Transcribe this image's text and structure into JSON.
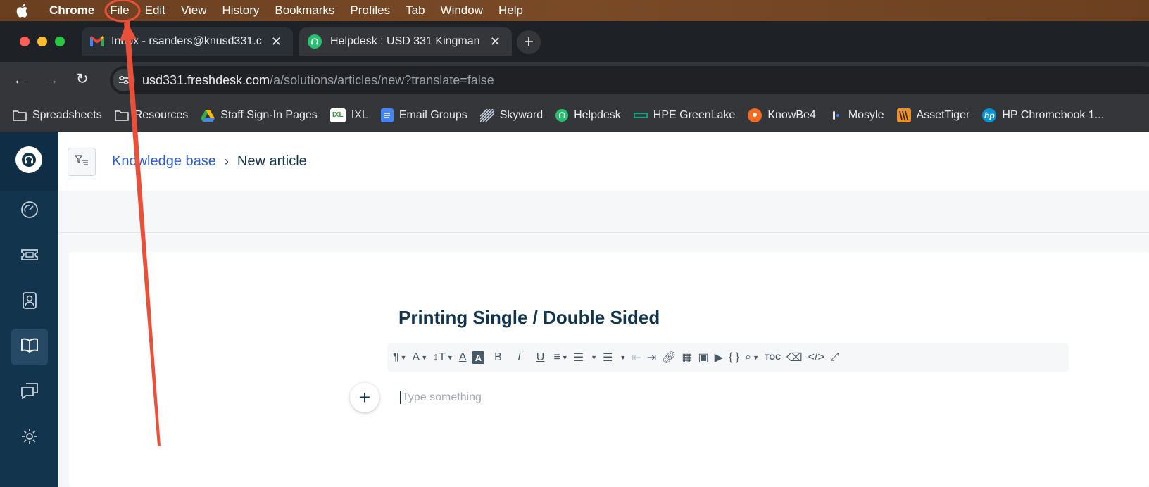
{
  "menubar": {
    "app_name": "Chrome",
    "items": [
      "File",
      "Edit",
      "View",
      "History",
      "Bookmarks",
      "Profiles",
      "Tab",
      "Window",
      "Help"
    ]
  },
  "tabs": [
    {
      "title": "Inbox - rsanders@knusd331.c",
      "icon": "gmail-icon",
      "active": false
    },
    {
      "title": "Helpdesk : USD 331 Kingman",
      "icon": "freshdesk-icon",
      "active": true
    }
  ],
  "address": {
    "host": "usd331.freshdesk.com",
    "path": "/a/solutions/articles/new?translate=false"
  },
  "bookmarks": [
    {
      "label": "Spreadsheets",
      "icon": "folder-icon"
    },
    {
      "label": "Resources",
      "icon": "folder-icon"
    },
    {
      "label": "Staff Sign-In Pages",
      "icon": "google-drive-icon"
    },
    {
      "label": "IXL",
      "icon": "ixl-icon"
    },
    {
      "label": "Email Groups",
      "icon": "google-docs-icon"
    },
    {
      "label": "Skyward",
      "icon": "skyward-icon"
    },
    {
      "label": "Helpdesk",
      "icon": "freshdesk-icon"
    },
    {
      "label": "HPE GreenLake",
      "icon": "hpe-icon"
    },
    {
      "label": "KnowBe4",
      "icon": "knowbe4-icon"
    },
    {
      "label": "Mosyle",
      "icon": "mosyle-icon"
    },
    {
      "label": "AssetTiger",
      "icon": "assettiger-icon"
    },
    {
      "label": "HP Chromebook 1...",
      "icon": "hp-icon"
    }
  ],
  "breadcrumb": {
    "parent": "Knowledge base",
    "current": "New article"
  },
  "editor": {
    "title": "Printing Single / Double Sided",
    "placeholder": "Type something",
    "toolbar": {
      "toc_label": "TOC",
      "code_block_label": "{ }"
    }
  },
  "colors": {
    "sidebar": "#12344d",
    "link": "#2c5cc5",
    "annotation": "#e8503a"
  }
}
